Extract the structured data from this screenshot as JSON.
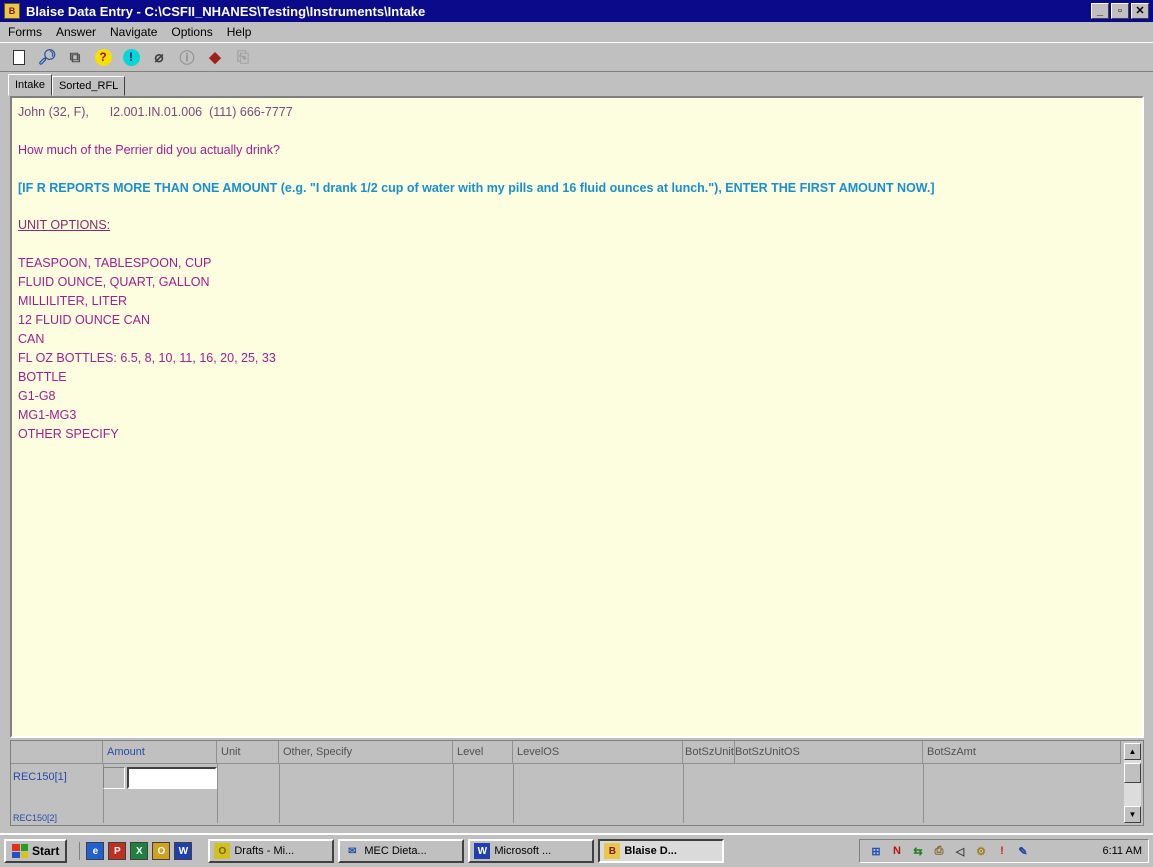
{
  "window": {
    "title": "Blaise Data Entry - C:\\CSFII_NHANES\\Testing\\Instruments\\Intake",
    "minimize_icon": "minimize-icon",
    "maximize_icon": "maximize-icon",
    "close_icon": "close-icon"
  },
  "menu": [
    "Forms",
    "Answer",
    "Navigate",
    "Options",
    "Help"
  ],
  "toolbar_icons": [
    "new-form-icon",
    "search-form-icon",
    "copy-form-icon",
    "help-icon",
    "info-icon",
    "attach-icon",
    "remark-icon",
    "watch-icon",
    "exit-icon"
  ],
  "tabs": [
    "Intake",
    "Sorted_RFL"
  ],
  "form": {
    "header": "John (32, F),      I2.001.IN.01.006  (111) 666-7777",
    "question": "How much of the Perrier did you actually drink?",
    "instruction": "[IF R REPORTS MORE THAN ONE AMOUNT (e.g. \"I drank 1/2 cup of water with my pills and 16 fluid ounces at lunch.\"), ENTER THE FIRST AMOUNT NOW.]",
    "unit_options_heading": "UNIT OPTIONS:",
    "unit_options": [
      "TEASPOON, TABLESPOON, CUP",
      "FLUID OUNCE, QUART, GALLON",
      "MILLILITER, LITER",
      "12 FLUID OUNCE CAN",
      "CAN",
      "FL OZ BOTTLES: 6.5, 8, 10, 11, 16, 20, 25, 33",
      "BOTTLE",
      "G1-G8",
      "MG1-MG3",
      "OTHER SPECIFY"
    ]
  },
  "grid": {
    "columns": [
      "Amount",
      "Unit",
      "Other, Specify",
      "Level",
      "LevelOS",
      "BotSzUnit",
      "BotSzUnitOS",
      "BotSzAmt"
    ],
    "row_label": "REC150[1]",
    "row2_label": "REC150[2]",
    "amount_value": ""
  },
  "taskbar": {
    "start_label": "Start",
    "quick_launch": [
      "ie-icon",
      "powerpoint-icon",
      "excel-icon",
      "outlook-icon",
      "word-icon"
    ],
    "tasks": [
      "Drafts - Mi...",
      "MEC Dieta...",
      "Microsoft ...",
      "Blaise D..."
    ],
    "clock": "6:11 AM"
  },
  "colors": {
    "title_bar": "#0a0a8a",
    "form_background": "#fdfde0",
    "question_text": "#a0208a",
    "instruction_text": "#1a8fd0"
  }
}
